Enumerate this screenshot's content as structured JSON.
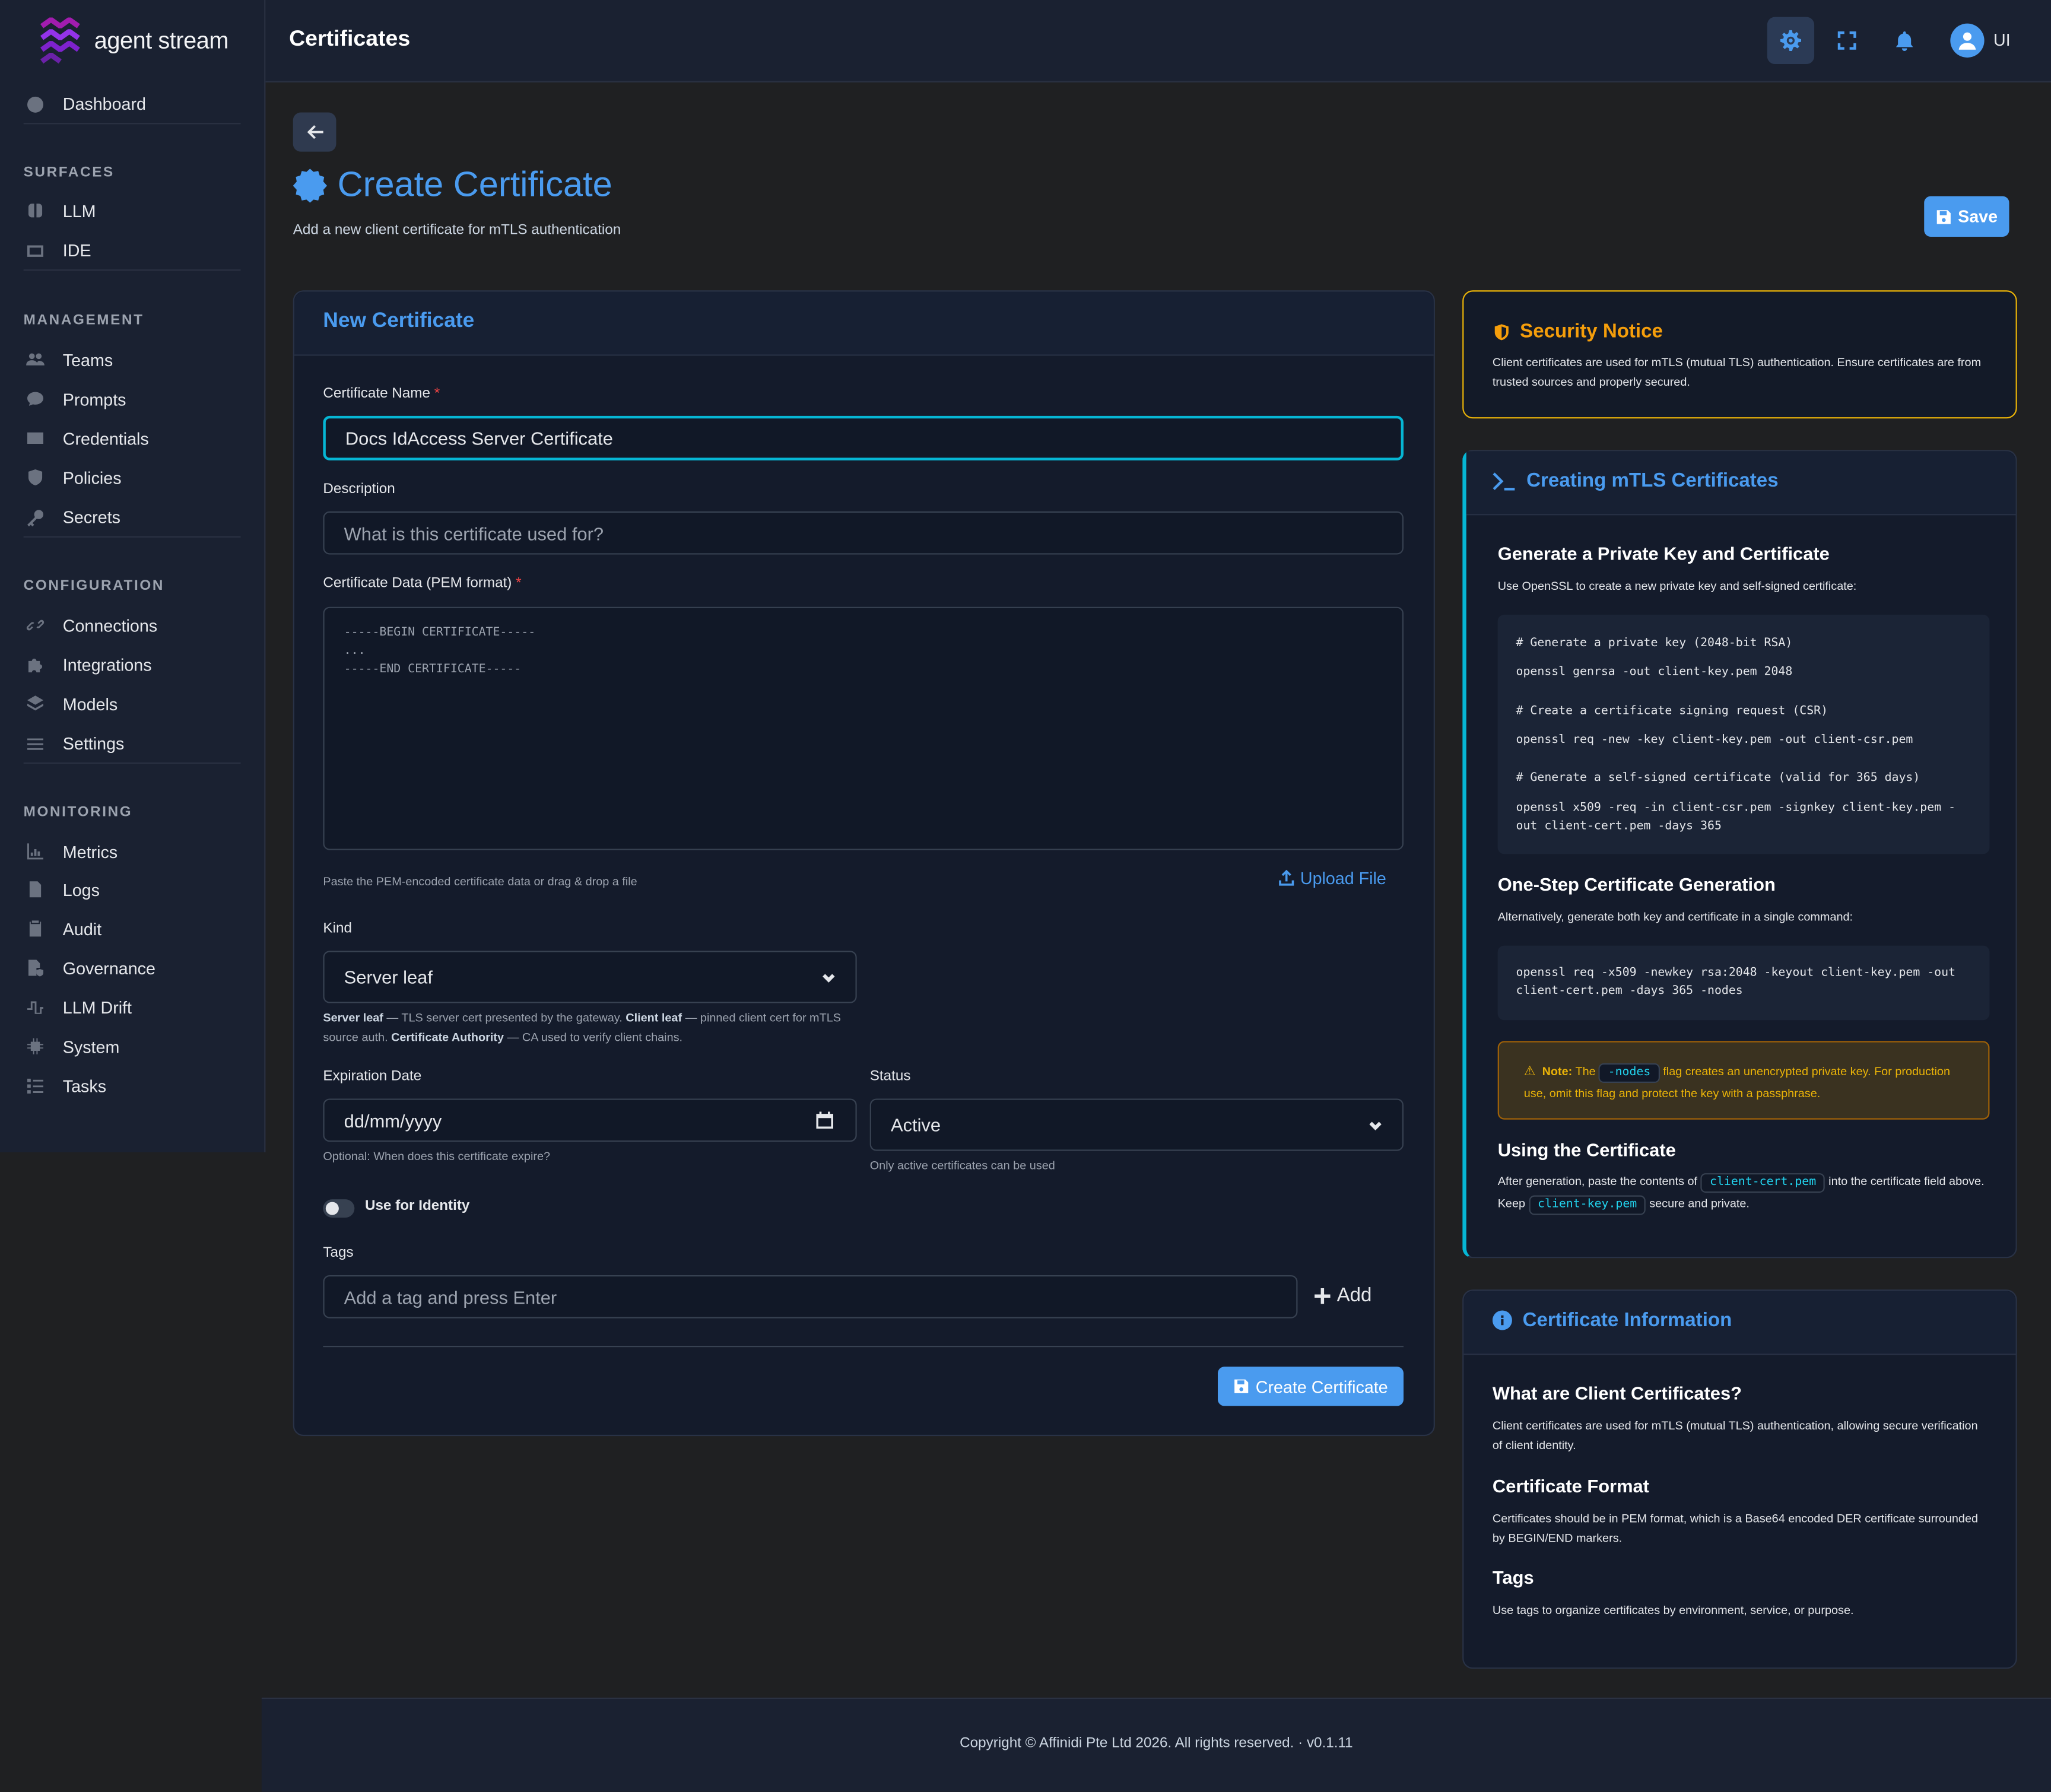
{
  "brand": {
    "name_part1": "agent",
    "name_part2": "stream"
  },
  "sidebar": {
    "dashboard": "Dashboard",
    "sections": {
      "surfaces": "SURFACES",
      "management": "MANAGEMENT",
      "configuration": "CONFIGURATION",
      "monitoring": "MONITORING"
    },
    "items": {
      "llm": "LLM",
      "ide": "IDE",
      "teams": "Teams",
      "prompts": "Prompts",
      "credentials": "Credentials",
      "policies": "Policies",
      "secrets": "Secrets",
      "connections": "Connections",
      "integrations": "Integrations",
      "models": "Models",
      "settings": "Settings",
      "metrics": "Metrics",
      "logs": "Logs",
      "audit": "Audit",
      "governance": "Governance",
      "llm_drift": "LLM Drift",
      "system": "System",
      "tasks": "Tasks"
    }
  },
  "topbar": {
    "title": "Certificates",
    "user_initials": "UI"
  },
  "page": {
    "title": "Create Certificate",
    "subtitle": "Add a new client certificate for mTLS authentication",
    "save_label": "Save"
  },
  "form": {
    "card_title": "New Certificate",
    "name_label": "Certificate Name",
    "name_value": "Docs IdAccess Server Certificate",
    "description_label": "Description",
    "description_placeholder": "What is this certificate used for?",
    "pem_label": "Certificate Data (PEM format)",
    "pem_placeholder": "-----BEGIN CERTIFICATE-----\n...\n-----END CERTIFICATE-----",
    "pem_help": "Paste the PEM-encoded certificate data or drag & drop a file",
    "upload_label": "Upload File",
    "kind_label": "Kind",
    "kind_value": "Server leaf",
    "kind_help": {
      "t1": "Server leaf",
      "t2": " — TLS server cert presented by the gateway. ",
      "t3": "Client leaf",
      "t4": " — pinned client cert for mTLS source auth. ",
      "t5": "Certificate Authority",
      "t6": " — CA used to verify client chains."
    },
    "expiry_label": "Expiration Date",
    "expiry_placeholder": "dd/mm/yyyy",
    "expiry_help": "Optional: When does this certificate expire?",
    "status_label": "Status",
    "status_value": "Active",
    "status_help": "Only active certificates can be used",
    "identity_label": "Use for Identity",
    "identity_on": false,
    "tags_label": "Tags",
    "tags_placeholder": "Add a tag and press Enter",
    "add_label": "Add",
    "create_label": "Create Certificate",
    "required_mark": "*"
  },
  "security_notice": {
    "title": "Security Notice",
    "body": "Client certificates are used for mTLS (mutual TLS) authentication. Ensure certificates are from trusted sources and properly secured."
  },
  "guide": {
    "title": "Creating mTLS Certificates",
    "h1": "Generate a Private Key and Certificate",
    "p1": "Use OpenSSL to create a new private key and self-signed certificate:",
    "code1": {
      "c1": "# Generate a private key (2048-bit RSA)",
      "l1": "openssl genrsa -out client-key.pem 2048",
      "c2": "# Create a certificate signing request (CSR)",
      "l2": "openssl req -new -key client-key.pem -out client-csr.pem",
      "c3": "# Generate a self-signed certificate (valid for 365 days)",
      "l3": "openssl x509 -req -in client-csr.pem -signkey client-key.pem -out client-cert.pem -days 365"
    },
    "h2": "One-Step Certificate Generation",
    "p2": "Alternatively, generate both key and certificate in a single command:",
    "code2": "openssl req -x509 -newkey rsa:2048 -keyout client-key.pem -out client-cert.pem -days 365 -nodes",
    "note": {
      "label": "Note:",
      "pre": "The",
      "chip": "-nodes",
      "post": "flag creates an unencrypted private key. For production use, omit this flag and protect the key with a passphrase."
    },
    "h3": "Using the Certificate",
    "p3": {
      "a": "After generation, paste the contents of",
      "chip1": "client-cert.pem",
      "b": "into the certificate field above. Keep",
      "chip2": "client-key.pem",
      "c": "secure and private."
    }
  },
  "info": {
    "title": "Certificate Information",
    "h1": "What are Client Certificates?",
    "p1": "Client certificates are used for mTLS (mutual TLS) authentication, allowing secure verification of client identity.",
    "h2": "Certificate Format",
    "p2": "Certificates should be in PEM format, which is a Base64 encoded DER certificate surrounded by BEGIN/END markers.",
    "h3": "Tags",
    "p3": "Use tags to organize certificates by environment, service, or purpose."
  },
  "footer": {
    "text": "Copyright © Affinidi Pte Ltd 2026. All rights reserved. · v0.1.11"
  },
  "colors": {
    "accent": "#4a9bef",
    "warning": "#eab308",
    "focus": "#06b6d4",
    "brand": "#a21caf"
  }
}
